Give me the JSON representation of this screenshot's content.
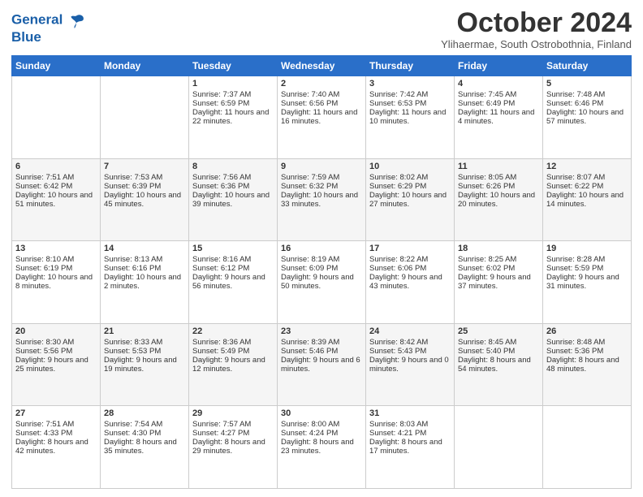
{
  "logo": {
    "line1": "General",
    "line2": "Blue"
  },
  "title": "October 2024",
  "subtitle": "Ylihaermae, South Ostrobothnia, Finland",
  "headers": [
    "Sunday",
    "Monday",
    "Tuesday",
    "Wednesday",
    "Thursday",
    "Friday",
    "Saturday"
  ],
  "weeks": [
    [
      {
        "day": "",
        "info": ""
      },
      {
        "day": "",
        "info": ""
      },
      {
        "day": "1",
        "info": "Sunrise: 7:37 AM\nSunset: 6:59 PM\nDaylight: 11 hours and 22 minutes."
      },
      {
        "day": "2",
        "info": "Sunrise: 7:40 AM\nSunset: 6:56 PM\nDaylight: 11 hours and 16 minutes."
      },
      {
        "day": "3",
        "info": "Sunrise: 7:42 AM\nSunset: 6:53 PM\nDaylight: 11 hours and 10 minutes."
      },
      {
        "day": "4",
        "info": "Sunrise: 7:45 AM\nSunset: 6:49 PM\nDaylight: 11 hours and 4 minutes."
      },
      {
        "day": "5",
        "info": "Sunrise: 7:48 AM\nSunset: 6:46 PM\nDaylight: 10 hours and 57 minutes."
      }
    ],
    [
      {
        "day": "6",
        "info": "Sunrise: 7:51 AM\nSunset: 6:42 PM\nDaylight: 10 hours and 51 minutes."
      },
      {
        "day": "7",
        "info": "Sunrise: 7:53 AM\nSunset: 6:39 PM\nDaylight: 10 hours and 45 minutes."
      },
      {
        "day": "8",
        "info": "Sunrise: 7:56 AM\nSunset: 6:36 PM\nDaylight: 10 hours and 39 minutes."
      },
      {
        "day": "9",
        "info": "Sunrise: 7:59 AM\nSunset: 6:32 PM\nDaylight: 10 hours and 33 minutes."
      },
      {
        "day": "10",
        "info": "Sunrise: 8:02 AM\nSunset: 6:29 PM\nDaylight: 10 hours and 27 minutes."
      },
      {
        "day": "11",
        "info": "Sunrise: 8:05 AM\nSunset: 6:26 PM\nDaylight: 10 hours and 20 minutes."
      },
      {
        "day": "12",
        "info": "Sunrise: 8:07 AM\nSunset: 6:22 PM\nDaylight: 10 hours and 14 minutes."
      }
    ],
    [
      {
        "day": "13",
        "info": "Sunrise: 8:10 AM\nSunset: 6:19 PM\nDaylight: 10 hours and 8 minutes."
      },
      {
        "day": "14",
        "info": "Sunrise: 8:13 AM\nSunset: 6:16 PM\nDaylight: 10 hours and 2 minutes."
      },
      {
        "day": "15",
        "info": "Sunrise: 8:16 AM\nSunset: 6:12 PM\nDaylight: 9 hours and 56 minutes."
      },
      {
        "day": "16",
        "info": "Sunrise: 8:19 AM\nSunset: 6:09 PM\nDaylight: 9 hours and 50 minutes."
      },
      {
        "day": "17",
        "info": "Sunrise: 8:22 AM\nSunset: 6:06 PM\nDaylight: 9 hours and 43 minutes."
      },
      {
        "day": "18",
        "info": "Sunrise: 8:25 AM\nSunset: 6:02 PM\nDaylight: 9 hours and 37 minutes."
      },
      {
        "day": "19",
        "info": "Sunrise: 8:28 AM\nSunset: 5:59 PM\nDaylight: 9 hours and 31 minutes."
      }
    ],
    [
      {
        "day": "20",
        "info": "Sunrise: 8:30 AM\nSunset: 5:56 PM\nDaylight: 9 hours and 25 minutes."
      },
      {
        "day": "21",
        "info": "Sunrise: 8:33 AM\nSunset: 5:53 PM\nDaylight: 9 hours and 19 minutes."
      },
      {
        "day": "22",
        "info": "Sunrise: 8:36 AM\nSunset: 5:49 PM\nDaylight: 9 hours and 12 minutes."
      },
      {
        "day": "23",
        "info": "Sunrise: 8:39 AM\nSunset: 5:46 PM\nDaylight: 9 hours and 6 minutes."
      },
      {
        "day": "24",
        "info": "Sunrise: 8:42 AM\nSunset: 5:43 PM\nDaylight: 9 hours and 0 minutes."
      },
      {
        "day": "25",
        "info": "Sunrise: 8:45 AM\nSunset: 5:40 PM\nDaylight: 8 hours and 54 minutes."
      },
      {
        "day": "26",
        "info": "Sunrise: 8:48 AM\nSunset: 5:36 PM\nDaylight: 8 hours and 48 minutes."
      }
    ],
    [
      {
        "day": "27",
        "info": "Sunrise: 7:51 AM\nSunset: 4:33 PM\nDaylight: 8 hours and 42 minutes."
      },
      {
        "day": "28",
        "info": "Sunrise: 7:54 AM\nSunset: 4:30 PM\nDaylight: 8 hours and 35 minutes."
      },
      {
        "day": "29",
        "info": "Sunrise: 7:57 AM\nSunset: 4:27 PM\nDaylight: 8 hours and 29 minutes."
      },
      {
        "day": "30",
        "info": "Sunrise: 8:00 AM\nSunset: 4:24 PM\nDaylight: 8 hours and 23 minutes."
      },
      {
        "day": "31",
        "info": "Sunrise: 8:03 AM\nSunset: 4:21 PM\nDaylight: 8 hours and 17 minutes."
      },
      {
        "day": "",
        "info": ""
      },
      {
        "day": "",
        "info": ""
      }
    ]
  ]
}
